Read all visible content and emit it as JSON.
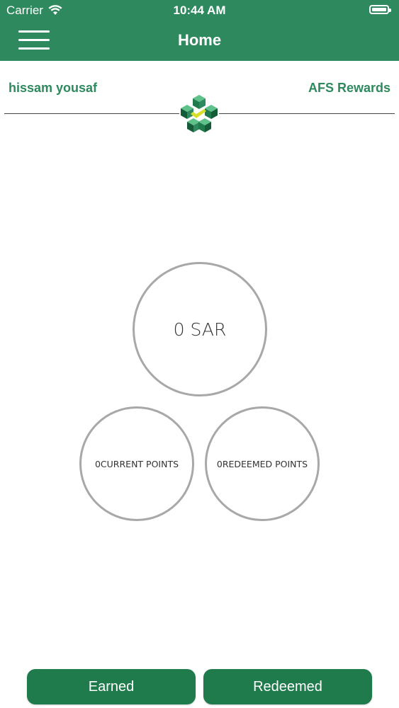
{
  "status_bar": {
    "carrier": "Carrier",
    "time": "10:44 AM",
    "wifi_icon": "wifi-icon",
    "battery_icon": "battery-icon"
  },
  "nav": {
    "title": "Home",
    "menu_icon": "hamburger-menu-icon"
  },
  "header": {
    "user_name": "hissam yousaf",
    "program": "AFS Rewards",
    "logo_icon": "afs-cube-logo"
  },
  "balance": {
    "sar": "0 SAR",
    "current_points": "0CURRENT POINTS",
    "redeemed_points": "0REDEEMED POINTS"
  },
  "footer": {
    "earned_label": "Earned",
    "redeemed_label": "Redeemed"
  },
  "colors": {
    "primary": "#2e8a5e",
    "button": "#1f7a4c",
    "circle_border": "#a8a8a8",
    "logo_accent": "#d6e02a"
  }
}
